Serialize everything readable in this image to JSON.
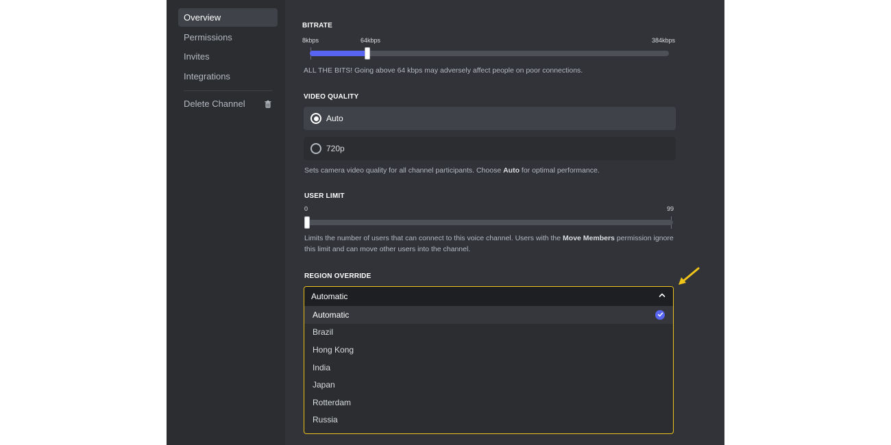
{
  "sidebar": {
    "items": [
      {
        "label": "Overview",
        "active": true
      },
      {
        "label": "Permissions"
      },
      {
        "label": "Invites"
      },
      {
        "label": "Integrations"
      }
    ],
    "delete": {
      "label": "Delete Channel",
      "icon": "trash-icon"
    }
  },
  "bitrate": {
    "title": "BITRATE",
    "ticks": [
      "8kbps",
      "64kbps",
      "384kbps"
    ],
    "value": 64,
    "min": 8,
    "max": 384,
    "help": "ALL THE BITS! Going above 64 kbps may adversely affect people on poor connections."
  },
  "video_quality": {
    "title": "VIDEO QUALITY",
    "options": [
      {
        "label": "Auto",
        "selected": true
      },
      {
        "label": "720p",
        "selected": false
      }
    ],
    "help_pre": "Sets camera video quality for all channel participants. Choose ",
    "help_bold": "Auto",
    "help_post": " for optimal performance."
  },
  "user_limit": {
    "title": "USER LIMIT",
    "min_label": "0",
    "max_label": "99",
    "value": 0,
    "help_pre": "Limits the number of users that can connect to this voice channel. Users with the ",
    "help_bold": "Move Members",
    "help_post": " permission ignore this limit and can move other users into the channel."
  },
  "region_override": {
    "title": "REGION OVERRIDE",
    "value": "Automatic",
    "options": [
      "Automatic",
      "Brazil",
      "Hong Kong",
      "India",
      "Japan",
      "Rotterdam",
      "Russia"
    ],
    "selected_index": 0
  },
  "colors": {
    "accent": "#5865f2",
    "highlight": "#f0c419"
  }
}
